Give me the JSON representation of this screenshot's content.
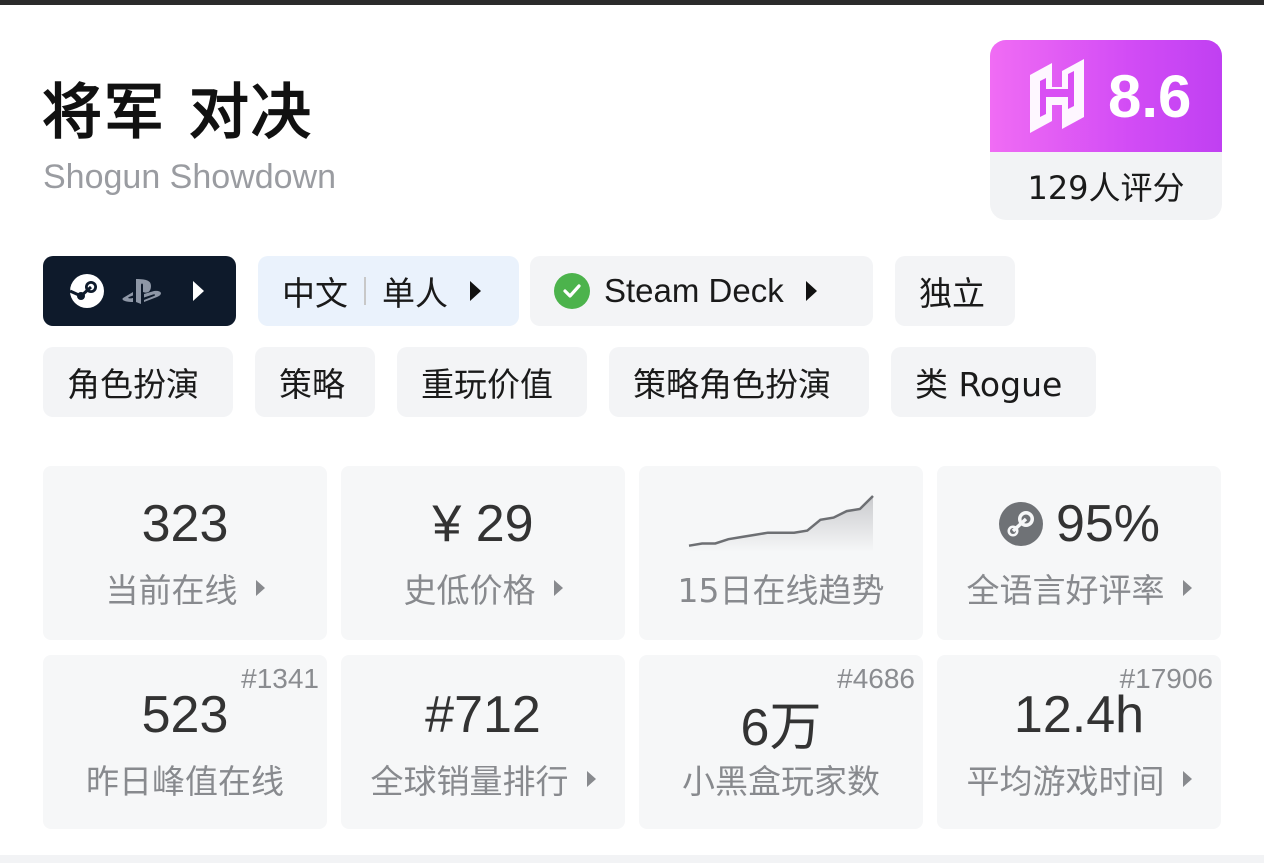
{
  "game": {
    "title": "将军 对决",
    "subtitle": "Shogun Showdown"
  },
  "score": {
    "value": "8.6",
    "count_label": "129人评分",
    "logo_icon": "heybox-logo-icon",
    "gradient": [
      "#f06cf4",
      "#c040f2"
    ]
  },
  "chips": {
    "platform_icons": [
      "steam-icon",
      "playstation-icon"
    ],
    "lang_label": "中文",
    "mode_label": "单人",
    "deck_label": "Steam Deck",
    "indie_label": "独立",
    "tags": [
      "角色扮演",
      "策略",
      "重玩价值",
      "策略角色扮演",
      "类 Rogue"
    ]
  },
  "stats": {
    "online": {
      "value": "323",
      "label": "当前在线"
    },
    "price": {
      "value": "¥ 29",
      "label": "史低价格"
    },
    "trend": {
      "label": "15日在线趋势",
      "points": [
        2,
        3,
        3,
        5,
        6,
        7,
        8,
        8,
        8,
        9,
        14,
        15,
        18,
        19,
        25
      ]
    },
    "rating": {
      "value": "95%",
      "label": "全语言好评率",
      "icon": "steam-icon"
    },
    "peak": {
      "value": "523",
      "label": "昨日峰值在线",
      "rank": "#1341"
    },
    "sales": {
      "value": "#712",
      "label": "全球销量排行"
    },
    "players": {
      "value": "6万",
      "label": "小黑盒玩家数",
      "rank": "#4686"
    },
    "playtime": {
      "value": "12.4h",
      "label": "平均游戏时间",
      "rank": "#17906"
    }
  }
}
